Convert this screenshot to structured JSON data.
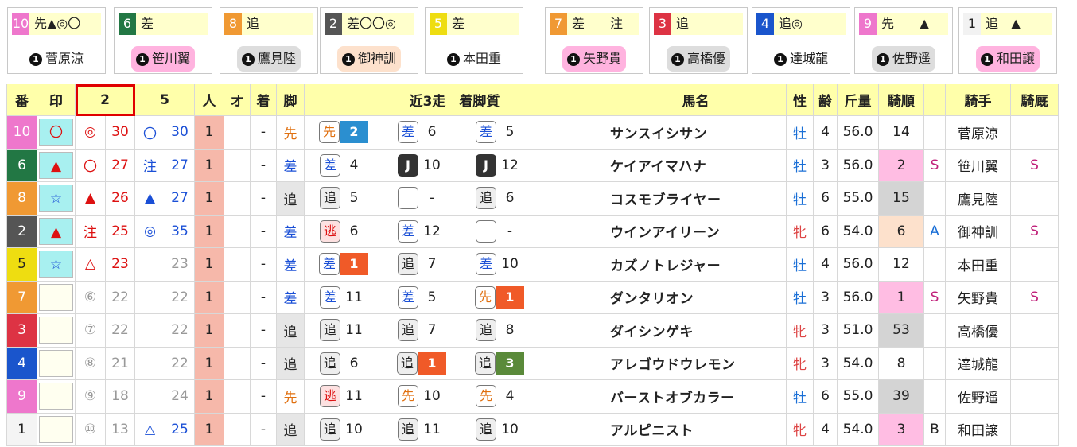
{
  "colors": {
    "c1": "#f0f0f0",
    "c2": "#333333",
    "c3": "#dd3344",
    "c4": "#2255cc",
    "c5": "#eedd11",
    "c6": "#227744",
    "c7": "#f08822",
    "c8": "#f08822",
    "c9": "#ee77cc",
    "c10": "#ee77cc"
  },
  "cards": [
    {
      "num": "10",
      "mark": "先▲◎〇",
      "jockey": "菅原涼",
      "jbg": "#ffffff",
      "ncolor": "#ee77cc",
      "ntext": "#ffffff"
    },
    {
      "num": "6",
      "mark": "差",
      "jockey": "笹川翼",
      "jbg": "#ffb3df",
      "ncolor": "#227744",
      "ntext": "#ffffff"
    },
    {
      "num": "8",
      "mark": "追",
      "jockey": "鷹見陸",
      "jbg": "#dddddd",
      "ncolor": "#f09933",
      "ntext": "#ffffff"
    },
    {
      "num": "2",
      "mark": "差〇〇◎",
      "jockey": "御神訓",
      "jbg": "#fde1cc",
      "ncolor": "#555555",
      "ntext": "#ffffff"
    },
    {
      "num": "5",
      "mark": "差",
      "jockey": "本田重",
      "jbg": "#ffffff",
      "ncolor": "#eedd11",
      "ntext": "#ffffff"
    },
    {
      "num": "7",
      "mark": "差　　注",
      "jockey": "矢野貴",
      "jbg": "#ffb3df",
      "ncolor": "#f09933",
      "ntext": "#ffffff"
    },
    {
      "num": "3",
      "mark": "追",
      "jockey": "高橋優",
      "jbg": "#dddddd",
      "ncolor": "#dd3344",
      "ntext": "#ffffff"
    },
    {
      "num": "4",
      "mark": "追◎",
      "jockey": "達城龍",
      "jbg": "#ffffff",
      "ncolor": "#1a55cc",
      "ntext": "#ffffff"
    },
    {
      "num": "9",
      "mark": "先　　▲",
      "jockey": "佐野遥",
      "jbg": "#dddddd",
      "ncolor": "#ee77cc",
      "ntext": "#ffffff"
    },
    {
      "num": "1",
      "mark": "追　▲",
      "jockey": "和田譲",
      "jbg": "#ffb3df",
      "ncolor": "#f2f2f2",
      "ntext": "#222222"
    }
  ],
  "header": {
    "ban": "番",
    "in": "印",
    "c2": "2",
    "c4": "5",
    "nin": "人",
    "o": "オ",
    "chaku": "着",
    "kyaku": "脚",
    "recent": "近3走　着脚質",
    "name": "馬名",
    "sex": "性",
    "age": "齢",
    "kinryo": "斤量",
    "kijun": "騎順",
    "kishu": "騎手",
    "kiyu": "騎厩"
  },
  "rows": [
    {
      "num": "10",
      "nbg": "#ee77cc",
      "ntext": "#fff",
      "mark": "〇",
      "markc": "red",
      "markbg": "cyan",
      "m2": "◎",
      "m2c": "red",
      "v2": "30",
      "v2c": "red",
      "m4": "〇",
      "m4c": "blue",
      "v4": "30",
      "v4c": "blue",
      "pop": "1",
      "chaku": "-",
      "kyaku": "先",
      "kyc": "orange",
      "kybg": "",
      "r": [
        {
          "s": "先",
          "sc": "orange",
          "sb": "#fff",
          "b": "2",
          "bb": "#2b8fd0"
        },
        {
          "s": "差",
          "sc": "blue",
          "sb": "#fff",
          "f": "6"
        },
        {
          "s": "差",
          "sc": "blue",
          "sb": "#fff",
          "f": "5"
        }
      ],
      "name": "サンスイシサン",
      "sex": "牡",
      "age": "4",
      "kin": "56.0",
      "ord": "14",
      "ordc": "",
      "k1": "",
      "jockey": "菅原涼",
      "k2": ""
    },
    {
      "num": "6",
      "nbg": "#227744",
      "ntext": "#fff",
      "mark": "▲",
      "markc": "red",
      "markbg": "cyan",
      "m2": "〇",
      "m2c": "red",
      "v2": "27",
      "v2c": "red",
      "m4": "注",
      "m4c": "blue",
      "v4": "27",
      "v4c": "blue",
      "pop": "1",
      "chaku": "-",
      "kyaku": "差",
      "kyc": "blue",
      "kybg": "",
      "r": [
        {
          "s": "差",
          "sc": "blue",
          "sb": "#fff",
          "f": "4"
        },
        {
          "s": "J",
          "sc": "white",
          "sb": "#333",
          "f": "10"
        },
        {
          "s": "J",
          "sc": "white",
          "sb": "#333",
          "f": "12"
        }
      ],
      "name": "ケイアイマハナ",
      "sex": "牡",
      "age": "3",
      "kin": "56.0",
      "ord": "2",
      "ordc": "pink",
      "k1": "S",
      "jockey": "笹川翼",
      "k2": "S"
    },
    {
      "num": "8",
      "nbg": "#f09933",
      "ntext": "#fff",
      "mark": "☆",
      "markc": "blue",
      "markbg": "cyan",
      "m2": "▲",
      "m2c": "red",
      "v2": "26",
      "v2c": "red",
      "m4": "▲",
      "m4c": "blue",
      "v4": "27",
      "v4c": "blue",
      "pop": "1",
      "chaku": "-",
      "kyaku": "追",
      "kyc": "dark",
      "kybg": "gray",
      "r": [
        {
          "s": "追",
          "sc": "dark",
          "sb": "#eee",
          "f": "5"
        },
        {
          "s": "",
          "sc": "dark",
          "sb": "#fff",
          "f": "-"
        },
        {
          "s": "追",
          "sc": "dark",
          "sb": "#eee",
          "f": "6"
        }
      ],
      "name": "コスモブライヤー",
      "sex": "牡",
      "age": "6",
      "kin": "55.0",
      "ord": "15",
      "ordc": "gray",
      "k1": "",
      "jockey": "鷹見陸",
      "k2": ""
    },
    {
      "num": "2",
      "nbg": "#555555",
      "ntext": "#fff",
      "mark": "▲",
      "markc": "red",
      "markbg": "cyan",
      "m2": "注",
      "m2c": "red",
      "v2": "25",
      "v2c": "red",
      "m4": "◎",
      "m4c": "blue",
      "v4": "35",
      "v4c": "blue",
      "pop": "1",
      "chaku": "-",
      "kyaku": "差",
      "kyc": "blue",
      "kybg": "",
      "r": [
        {
          "s": "逃",
          "sc": "red",
          "sb": "#fde1e1",
          "f": "6"
        },
        {
          "s": "差",
          "sc": "blue",
          "sb": "#fff",
          "f": "12"
        },
        {
          "s": "",
          "sc": "dark",
          "sb": "#fff",
          "f": "-"
        }
      ],
      "name": "ウインアイリーン",
      "sex": "牝",
      "age": "6",
      "kin": "54.0",
      "ord": "6",
      "ordc": "peach",
      "k1": "A",
      "jockey": "御神訓",
      "k2": "S"
    },
    {
      "num": "5",
      "nbg": "#eedd11",
      "ntext": "#222",
      "mark": "☆",
      "markc": "blue",
      "markbg": "cyan",
      "m2": "△",
      "m2c": "red",
      "v2": "23",
      "v2c": "red",
      "m4": "",
      "m4c": "blue",
      "v4": "23",
      "v4c": "gray",
      "pop": "1",
      "chaku": "-",
      "kyaku": "差",
      "kyc": "blue",
      "kybg": "",
      "r": [
        {
          "s": "差",
          "sc": "blue",
          "sb": "#fff",
          "b": "1",
          "bb": "#f05a28"
        },
        {
          "s": "追",
          "sc": "dark",
          "sb": "#eee",
          "f": "7"
        },
        {
          "s": "差",
          "sc": "blue",
          "sb": "#fff",
          "f": "10"
        }
      ],
      "name": "カズノトレジャー",
      "sex": "牡",
      "age": "4",
      "kin": "56.0",
      "ord": "12",
      "ordc": "",
      "k1": "",
      "jockey": "本田重",
      "k2": ""
    },
    {
      "num": "7",
      "nbg": "#f09933",
      "ntext": "#fff",
      "mark": "",
      "markc": "red",
      "markbg": "empty",
      "m2": "⑥",
      "m2c": "gray",
      "v2": "22",
      "v2c": "gray",
      "m4": "",
      "m4c": "blue",
      "v4": "22",
      "v4c": "gray",
      "pop": "1",
      "chaku": "-",
      "kyaku": "差",
      "kyc": "blue",
      "kybg": "",
      "r": [
        {
          "s": "差",
          "sc": "blue",
          "sb": "#fff",
          "f": "11"
        },
        {
          "s": "差",
          "sc": "blue",
          "sb": "#fff",
          "f": "5"
        },
        {
          "s": "先",
          "sc": "orange",
          "sb": "#fff",
          "b": "1",
          "bb": "#f05a28"
        }
      ],
      "name": "ダンタリオン",
      "sex": "牡",
      "age": "3",
      "kin": "56.0",
      "ord": "1",
      "ordc": "pink",
      "k1": "S",
      "jockey": "矢野貴",
      "k2": "S"
    },
    {
      "num": "3",
      "nbg": "#dd3344",
      "ntext": "#fff",
      "mark": "",
      "markc": "red",
      "markbg": "empty",
      "m2": "⑦",
      "m2c": "gray",
      "v2": "22",
      "v2c": "gray",
      "m4": "",
      "m4c": "blue",
      "v4": "22",
      "v4c": "gray",
      "pop": "1",
      "chaku": "-",
      "kyaku": "追",
      "kyc": "dark",
      "kybg": "gray",
      "r": [
        {
          "s": "追",
          "sc": "dark",
          "sb": "#eee",
          "f": "11"
        },
        {
          "s": "追",
          "sc": "dark",
          "sb": "#eee",
          "f": "7"
        },
        {
          "s": "追",
          "sc": "dark",
          "sb": "#eee",
          "f": "8"
        }
      ],
      "name": "ダイシンゲキ",
      "sex": "牝",
      "age": "3",
      "kin": "51.0",
      "ord": "53",
      "ordc": "gray",
      "k1": "",
      "jockey": "高橋優",
      "k2": ""
    },
    {
      "num": "4",
      "nbg": "#1a55cc",
      "ntext": "#fff",
      "mark": "",
      "markc": "red",
      "markbg": "empty",
      "m2": "⑧",
      "m2c": "gray",
      "v2": "21",
      "v2c": "gray",
      "m4": "",
      "m4c": "blue",
      "v4": "22",
      "v4c": "gray",
      "pop": "1",
      "chaku": "-",
      "kyaku": "追",
      "kyc": "dark",
      "kybg": "gray",
      "r": [
        {
          "s": "追",
          "sc": "dark",
          "sb": "#eee",
          "f": "6"
        },
        {
          "s": "追",
          "sc": "dark",
          "sb": "#eee",
          "b": "1",
          "bb": "#f05a28"
        },
        {
          "s": "追",
          "sc": "dark",
          "sb": "#eee",
          "b": "3",
          "bb": "#5a8a3a"
        }
      ],
      "name": "アレゴウドウレモン",
      "sex": "牝",
      "age": "3",
      "kin": "54.0",
      "ord": "8",
      "ordc": "",
      "k1": "",
      "jockey": "達城龍",
      "k2": ""
    },
    {
      "num": "9",
      "nbg": "#ee77cc",
      "ntext": "#fff",
      "mark": "",
      "markc": "red",
      "markbg": "empty",
      "m2": "⑨",
      "m2c": "gray",
      "v2": "18",
      "v2c": "gray",
      "m4": "",
      "m4c": "blue",
      "v4": "24",
      "v4c": "gray",
      "pop": "1",
      "chaku": "-",
      "kyaku": "先",
      "kyc": "orange",
      "kybg": "",
      "r": [
        {
          "s": "逃",
          "sc": "red",
          "sb": "#fde1e1",
          "f": "11"
        },
        {
          "s": "先",
          "sc": "orange",
          "sb": "#fff",
          "f": "10"
        },
        {
          "s": "先",
          "sc": "orange",
          "sb": "#fff",
          "f": "4"
        }
      ],
      "name": "バーストオブカラー",
      "sex": "牡",
      "age": "6",
      "kin": "55.0",
      "ord": "39",
      "ordc": "gray",
      "k1": "",
      "jockey": "佐野遥",
      "k2": ""
    },
    {
      "num": "1",
      "nbg": "#f4f4f4",
      "ntext": "#222",
      "mark": "",
      "markc": "red",
      "markbg": "empty",
      "m2": "⑩",
      "m2c": "gray",
      "v2": "13",
      "v2c": "gray",
      "m4": "△",
      "m4c": "blue",
      "v4": "25",
      "v4c": "blue",
      "pop": "1",
      "chaku": "-",
      "kyaku": "追",
      "kyc": "dark",
      "kybg": "gray",
      "r": [
        {
          "s": "追",
          "sc": "dark",
          "sb": "#eee",
          "f": "10"
        },
        {
          "s": "追",
          "sc": "dark",
          "sb": "#eee",
          "f": "11"
        },
        {
          "s": "追",
          "sc": "dark",
          "sb": "#eee",
          "f": "10"
        }
      ],
      "name": "アルピニスト",
      "sex": "牝",
      "age": "4",
      "kin": "54.0",
      "ord": "3",
      "ordc": "pink",
      "k1": "B",
      "jockey": "和田譲",
      "k2": ""
    }
  ]
}
